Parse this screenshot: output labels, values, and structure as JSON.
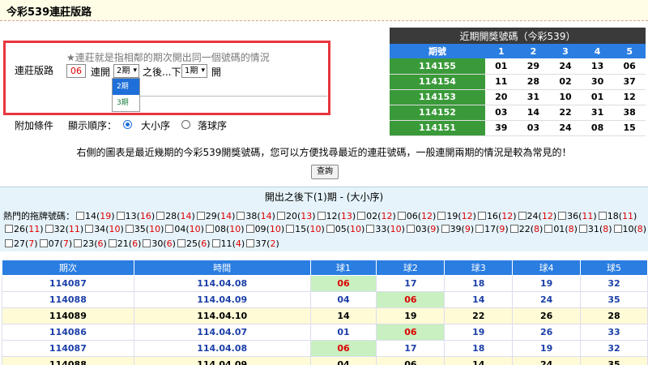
{
  "page_title": "今彩539連莊版路",
  "form": {
    "label": "連莊版路",
    "hint": "★連莊就是指相鄰的期次開出同一個號碼的情況",
    "number": "06",
    "text_connect": "連開",
    "select_periods": "2期",
    "text_after": "之後...下",
    "select_next": "1期",
    "text_open": "開",
    "dropdown_options": [
      "2期",
      "3期"
    ]
  },
  "extra": {
    "label": "附加條件",
    "order_label": "顯示順序：",
    "option_size": "大小序",
    "option_drop": "落球序",
    "selected": "大小序"
  },
  "recent": {
    "caption": "近期開獎號碼（今彩539）",
    "headers": [
      "期號",
      "1",
      "2",
      "3",
      "4",
      "5"
    ],
    "rows": [
      [
        "114155",
        "01",
        "29",
        "24",
        "13",
        "06"
      ],
      [
        "114154",
        "11",
        "28",
        "02",
        "30",
        "37"
      ],
      [
        "114153",
        "20",
        "31",
        "10",
        "01",
        "12"
      ],
      [
        "114152",
        "03",
        "14",
        "22",
        "31",
        "38"
      ],
      [
        "114151",
        "39",
        "03",
        "24",
        "08",
        "15"
      ]
    ]
  },
  "info_text": "右側的圖表是最近幾期的今彩539開獎號碼，您可以方便找尋最近的連莊號碼，一般連開兩期的情況是較為常見的！",
  "query_button": "查詢",
  "hot": {
    "title": "開出之後下(1)期 - (大小序)",
    "prefix": "熱門的拖牌號碼：",
    "items": [
      [
        "14",
        "19"
      ],
      [
        "13",
        "16"
      ],
      [
        "28",
        "14"
      ],
      [
        "29",
        "14"
      ],
      [
        "38",
        "14"
      ],
      [
        "20",
        "13"
      ],
      [
        "12",
        "13"
      ],
      [
        "02",
        "12"
      ],
      [
        "06",
        "12"
      ],
      [
        "19",
        "12"
      ],
      [
        "16",
        "12"
      ],
      [
        "24",
        "12"
      ],
      [
        "36",
        "11"
      ],
      [
        "18",
        "11"
      ],
      [
        "26",
        "11"
      ],
      [
        "32",
        "11"
      ],
      [
        "34",
        "10"
      ],
      [
        "35",
        "10"
      ],
      [
        "04",
        "10"
      ],
      [
        "08",
        "10"
      ],
      [
        "09",
        "10"
      ],
      [
        "15",
        "10"
      ],
      [
        "05",
        "10"
      ],
      [
        "33",
        "10"
      ],
      [
        "03",
        "9"
      ],
      [
        "39",
        "9"
      ],
      [
        "17",
        "9"
      ],
      [
        "22",
        "8"
      ],
      [
        "01",
        "8"
      ],
      [
        "31",
        "8"
      ],
      [
        "10",
        "8"
      ],
      [
        "27",
        "7"
      ],
      [
        "07",
        "7"
      ],
      [
        "23",
        "6"
      ],
      [
        "21",
        "6"
      ],
      [
        "30",
        "6"
      ],
      [
        "25",
        "6"
      ],
      [
        "11",
        "4"
      ],
      [
        "37",
        "2"
      ]
    ]
  },
  "results": {
    "headers": [
      "期次",
      "時間",
      "球1",
      "球2",
      "球3",
      "球4",
      "球5"
    ],
    "rows": [
      {
        "cells": [
          "114087",
          "114.04.08",
          "06",
          "17",
          "18",
          "19",
          "32"
        ],
        "style": "w",
        "hit": 2
      },
      {
        "cells": [
          "114088",
          "114.04.09",
          "04",
          "06",
          "14",
          "24",
          "35"
        ],
        "style": "w",
        "hit": 3
      },
      {
        "cells": [
          "114089",
          "114.04.10",
          "14",
          "19",
          "22",
          "26",
          "28"
        ],
        "style": "y",
        "hit": -1
      },
      {
        "cells": [
          "114086",
          "114.04.07",
          "01",
          "06",
          "19",
          "26",
          "33"
        ],
        "style": "w",
        "hit": 3
      },
      {
        "cells": [
          "114087",
          "114.04.08",
          "06",
          "17",
          "18",
          "19",
          "32"
        ],
        "style": "w",
        "hit": 2
      },
      {
        "cells": [
          "114088",
          "114.04.09",
          "04",
          "06",
          "14",
          "24",
          "35"
        ],
        "style": "y",
        "hit": -1
      }
    ]
  },
  "colors": {
    "accent_blue": "#2a7de1",
    "green": "#3a9a3a",
    "hit_bg": "#c8f0c0",
    "red": "#dd0000"
  }
}
